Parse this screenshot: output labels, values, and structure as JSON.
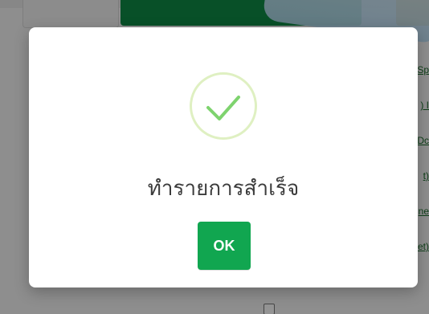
{
  "colors": {
    "overlay": "#000000",
    "ok_button": "#11a650",
    "success_icon_ring": "#dff0c2",
    "success_check": "#7ed36e",
    "text": "#3c3c3c",
    "link": "#1b6d2c"
  },
  "dialog": {
    "icon": "check-circle-icon",
    "message": "ทำรายการสำเร็จ",
    "ok_label": "OK"
  },
  "background": {
    "right_links": [
      "Sp",
      ") I",
      "Dc",
      "t)",
      "ne",
      "et)"
    ]
  }
}
